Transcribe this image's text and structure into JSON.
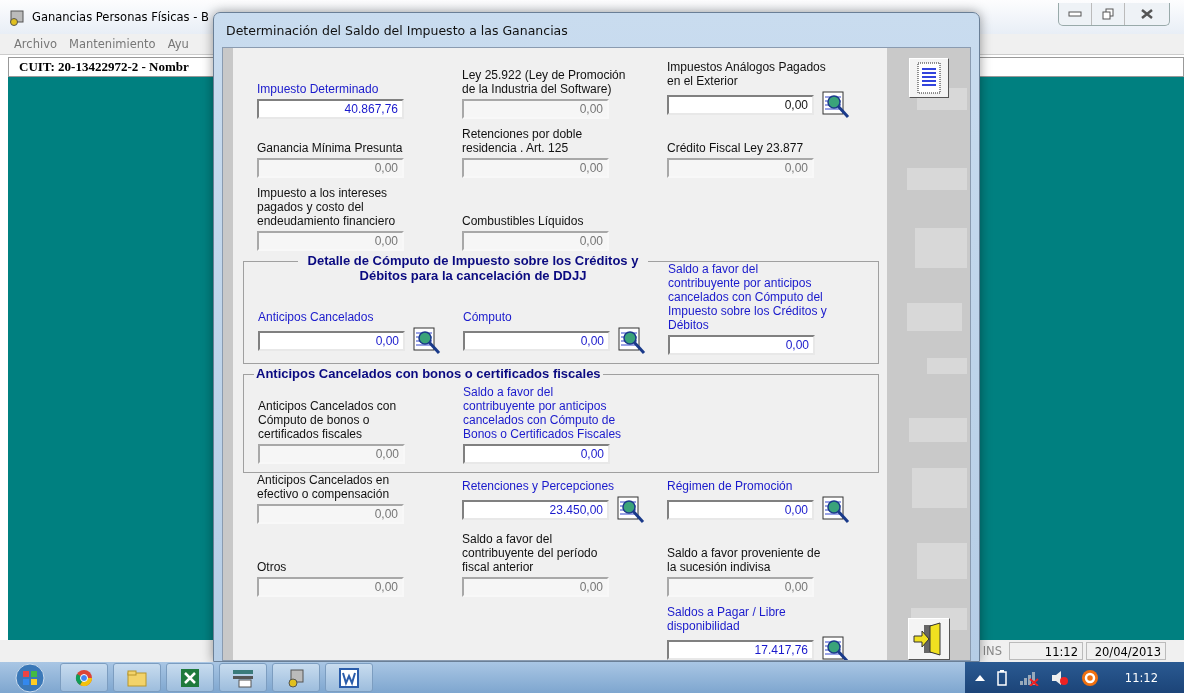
{
  "main_window": {
    "title": "Ganancias Personas Físicas - B",
    "menu": [
      {
        "label": "Archivo"
      },
      {
        "label": "Mantenimiento"
      },
      {
        "label": "Ayu"
      }
    ],
    "cuit_bar": "CUIT: 20-13422972-2 -  Nombr",
    "status_bar": {
      "mode": "INS",
      "time": "11:12",
      "date": "20/04/2013"
    }
  },
  "dialog": {
    "title": "Determinación del Saldo del Impuesto a las Ganancias",
    "sections": [
      {
        "kind": "plain",
        "rows": [
          [
            {
              "label": "Impuesto Determinado",
              "value": "40.867,76",
              "enabled": true,
              "calculated": true,
              "lookup": false
            },
            {
              "label": "Ley 25.922 (Ley de Promoción de la Industria del Software)",
              "value": "0,00",
              "enabled": false,
              "calculated": false,
              "lookup": false
            },
            {
              "label": "Impuestos Análogos Pagados en el Exterior",
              "value": "0,00",
              "enabled": true,
              "calculated": false,
              "lookup": true
            }
          ],
          [
            {
              "label": "Ganancia Mínima Presunta",
              "value": "0,00",
              "enabled": false,
              "calculated": false,
              "lookup": false
            },
            {
              "label": "Retenciones por doble residencia . Art. 125",
              "value": "0,00",
              "enabled": false,
              "calculated": false,
              "lookup": false
            },
            {
              "label": "Crédito Fiscal Ley 23.877",
              "value": "0,00",
              "enabled": false,
              "calculated": false,
              "lookup": false
            }
          ],
          [
            {
              "label": "Impuesto a los intereses pagados y costo del endeudamiento financiero",
              "value": "0,00",
              "enabled": false,
              "calculated": false,
              "lookup": false
            },
            {
              "label": "Combustibles Líquidos",
              "value": "0,00",
              "enabled": false,
              "calculated": false,
              "lookup": false
            },
            null
          ]
        ]
      },
      {
        "kind": "centered_group",
        "title": "Detalle de Cómputo de Impuesto sobre los Créditos y Débitos para la cancelación de DDJJ",
        "rows": [
          [
            {
              "label": "Anticipos Cancelados",
              "value": "0,00",
              "enabled": true,
              "calculated": true,
              "lookup": true
            },
            {
              "label": "Cómputo",
              "value": "0,00",
              "enabled": true,
              "calculated": true,
              "lookup": true
            },
            {
              "label": "Saldo a favor del contribuyente por anticipos cancelados con Cómputo del Impuesto sobre los Créditos y Débitos",
              "value": "0,00",
              "enabled": true,
              "calculated": true,
              "lookup": false
            }
          ]
        ]
      },
      {
        "kind": "group",
        "title": "Anticipos Cancelados con bonos o certificados fiscales",
        "rows": [
          [
            {
              "label": "Anticipos Cancelados con Cómputo de bonos o certificados fiscales",
              "value": "0,00",
              "enabled": false,
              "calculated": false,
              "lookup": false
            },
            {
              "label": "Saldo a favor del contribuyente por anticipos cancelados con Cómputo de Bonos o Certificados Fiscales",
              "value": "0,00",
              "enabled": true,
              "calculated": true,
              "lookup": false
            },
            null
          ]
        ]
      },
      {
        "kind": "plain",
        "rows": [
          [
            {
              "label": "Anticipos Cancelados en efectivo o compensación",
              "value": "0,00",
              "enabled": false,
              "calculated": false,
              "lookup": false
            },
            {
              "label": "Retenciones y Percepciones",
              "value": "23.450,00",
              "enabled": true,
              "calculated": true,
              "lookup": true
            },
            {
              "label": "Régimen de Promoción",
              "value": "0,00",
              "enabled": true,
              "calculated": true,
              "lookup": true
            }
          ],
          [
            {
              "label": "Otros",
              "value": "0,00",
              "enabled": false,
              "calculated": false,
              "lookup": false
            },
            {
              "label": "Saldo a favor del contribuyente del período fiscal anterior",
              "value": "0,00",
              "enabled": false,
              "calculated": false,
              "lookup": false
            },
            {
              "label": "Saldo a favor proveniente de la sucesión indivisa",
              "value": "0,00",
              "enabled": false,
              "calculated": false,
              "lookup": false
            }
          ],
          [
            null,
            null,
            {
              "label": "Saldos a Pagar / Libre disponibilidad",
              "value": "17.417,76",
              "enabled": true,
              "calculated": true,
              "lookup": true
            }
          ]
        ]
      }
    ]
  },
  "taskbar": {
    "clock": "11:12"
  }
}
